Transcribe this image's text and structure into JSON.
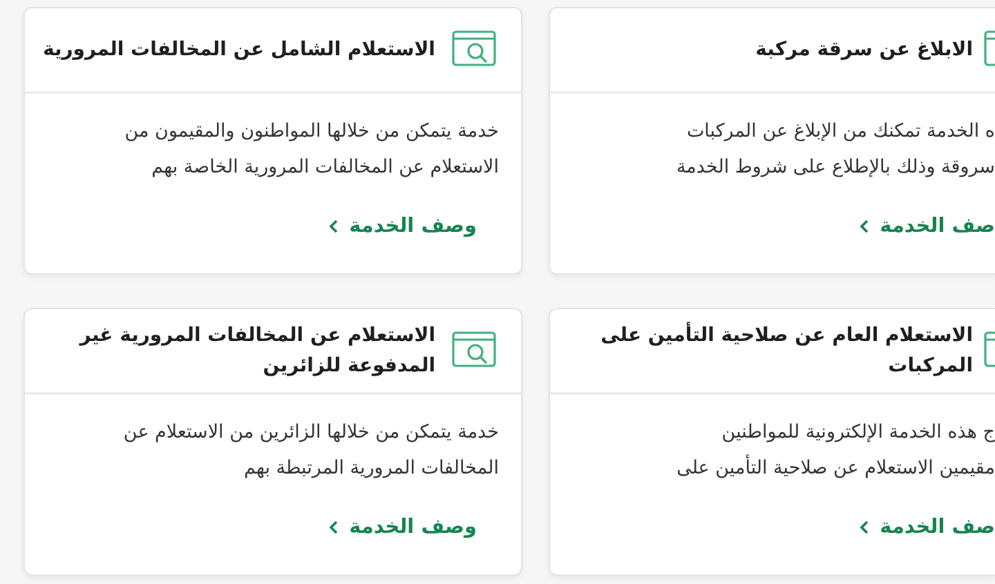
{
  "rows": [
    {
      "cards": [
        {
          "cut_off": true,
          "title": [
            "الابلاغ عن سرقة مركبة"
          ],
          "description": [
            "ه الخدمة تمكنك من الإبلاغ عن المركبات",
            "سروقة وذلك بالإطلاع على شروط الخدمة"
          ],
          "link": "صف الخدمة"
        },
        {
          "cut_off": false,
          "title": [
            "الاستعلام الشامل عن المخالفات المرورية"
          ],
          "description": [
            "خدمة يتمكن من خلالها المواطنون والمقيمون من",
            "الاستعلام عن المخالفات المرورية الخاصة بهم"
          ],
          "link": "وصف الخدمة"
        }
      ]
    },
    {
      "cards": [
        {
          "cut_off": true,
          "title": [
            "الاستعلام العام عن صلاحية التأمين على",
            "المركبات"
          ],
          "description": [
            "ج هذه الخدمة الإلكترونية للمواطنين",
            "مقيمين الاستعلام عن صلاحية التأمين على"
          ],
          "link": "صف الخدمة"
        },
        {
          "cut_off": false,
          "title": [
            "الاستعلام عن المخالفات المرورية غير",
            "المدفوعة للزائرين"
          ],
          "description": [
            "خدمة يتمكن من خلالها الزائرين من الاستعلام عن",
            "المخالفات المرورية المرتبطة بهم"
          ],
          "link": "وصف الخدمة"
        }
      ]
    }
  ]
}
